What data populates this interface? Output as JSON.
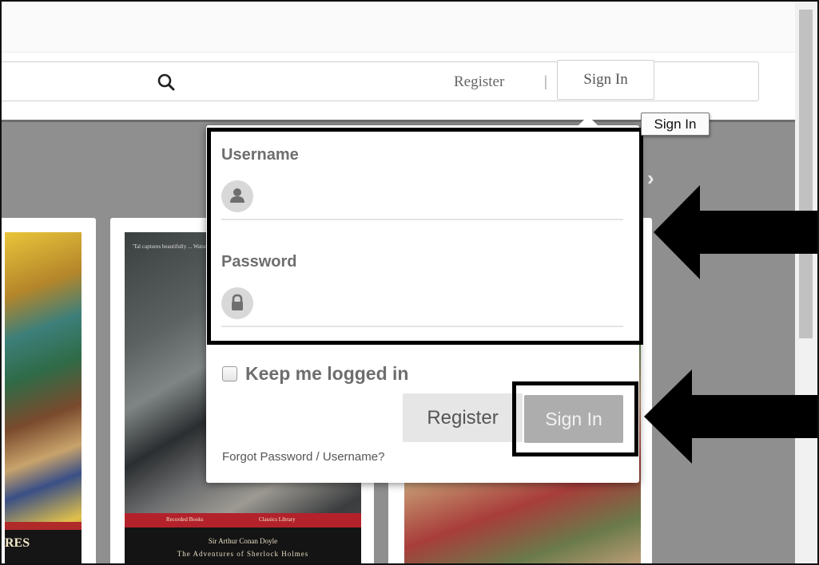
{
  "header": {
    "search_placeholder": "",
    "register_label": "Register",
    "divider": "|",
    "signin_label": "Sign In"
  },
  "tooltip": {
    "text": "Sign In"
  },
  "login": {
    "username_label": "Username",
    "username_value": "",
    "password_label": "Password",
    "password_value": "",
    "keep_logged_in_label": "Keep me logged in",
    "keep_logged_in_checked": false,
    "register_button": "Register",
    "signin_button": "Sign In",
    "forgot_link": "Forgot Password / Username?"
  },
  "carousel": {
    "next_icon": "chevron-right-icon",
    "books": [
      {
        "partial_title": "RES"
      },
      {
        "quote": "'Tal captures beautifully ... Watson's ...'",
        "publisher": "Recorded Books",
        "series": "Classics Library",
        "author": "Sir Arthur Conan Doyle",
        "title": "The Adventures of Sherlock Holmes"
      },
      {
        "cover_art": "fresco painting"
      }
    ]
  },
  "annotations": {
    "arrow_color": "#000000",
    "box_color": "#000000"
  },
  "colors": {
    "content_bg": "#8f8f8f",
    "signin_button_bg": "#adadad",
    "register_button_bg": "#e6e6e6"
  }
}
